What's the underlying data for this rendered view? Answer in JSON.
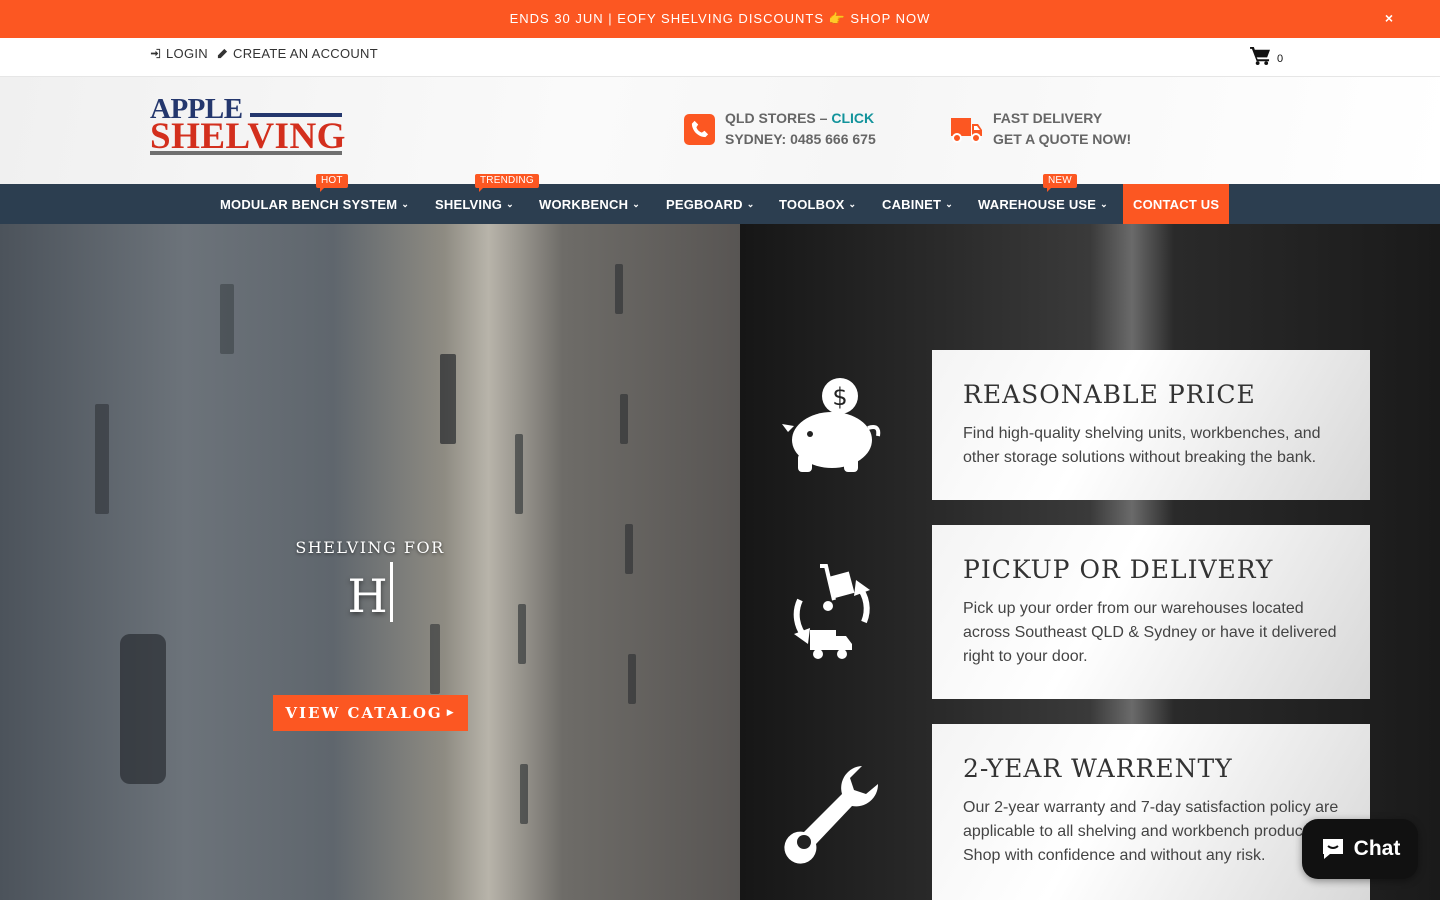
{
  "announcement": {
    "text": "ENDS 30 JUN | EOFY SHELVING DISCOUNTS 👉 SHOP NOW",
    "close": "×"
  },
  "account": {
    "login": "LOGIN",
    "create": "CREATE AN ACCOUNT",
    "cart_count": "0"
  },
  "logo": {
    "line1": "APPLE",
    "line2": "SHELVING"
  },
  "header": {
    "stores_label": "QLD STORES – ",
    "stores_link": "CLICK",
    "sydney": "SYDNEY: 0485 666 675",
    "delivery": "FAST DELIVERY",
    "quote": "GET A QUOTE NOW!"
  },
  "nav": {
    "items": [
      {
        "label": "MODULAR BENCH SYSTEM",
        "badge": "HOT"
      },
      {
        "label": "SHELVING",
        "badge": "TRENDING"
      },
      {
        "label": "WORKBENCH"
      },
      {
        "label": "PEGBOARD"
      },
      {
        "label": "TOOLBOX"
      },
      {
        "label": "CABINET"
      },
      {
        "label": "WAREHOUSE USE",
        "badge": "NEW"
      }
    ],
    "contact": "CONTACT US"
  },
  "hero": {
    "title": "SHELVING FOR",
    "typed": "H",
    "cta": "VIEW CATALOG"
  },
  "features": [
    {
      "icon": "piggy-bank-icon",
      "title": "REASONABLE PRICE",
      "text": "Find high-quality shelving units, workbenches, and other storage solutions without breaking the bank."
    },
    {
      "icon": "pickup-delivery-icon",
      "title": "PICKUP OR DELIVERY",
      "text": "Pick up your order from our warehouses located across Southeast QLD & Sydney or have it delivered right to your door."
    },
    {
      "icon": "wrench-icon",
      "title": "2-YEAR WARRENTY",
      "text": "Our 2-year warranty and 7-day satisfaction policy are applicable to all shelving and workbench products. Shop with confidence and without any risk."
    }
  ],
  "chat": {
    "label": "Chat"
  },
  "colors": {
    "accent": "#fc5722",
    "nav_bg": "#2c3e50",
    "brand_blue": "#24376d",
    "brand_red": "#d32f1d",
    "link_teal": "#12939b"
  }
}
